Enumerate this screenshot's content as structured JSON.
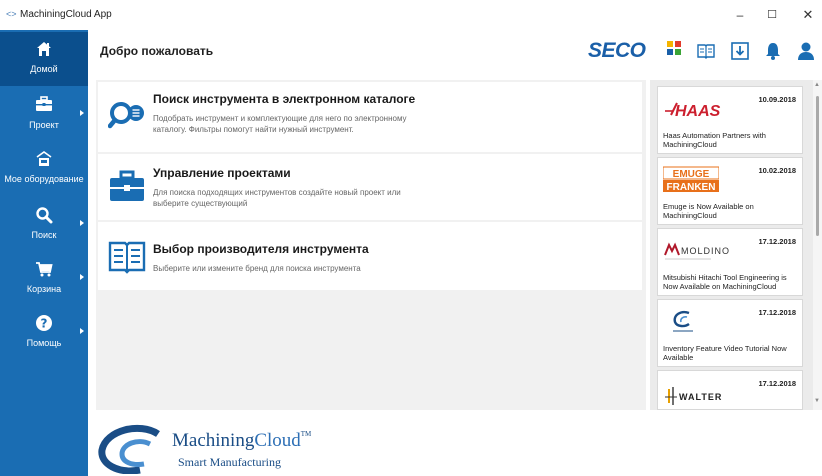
{
  "window": {
    "title": "MachiningCloud App",
    "controls": {
      "minimize": "–",
      "maximize": "☐",
      "close": "✕"
    }
  },
  "sidebar": {
    "items": [
      {
        "label": "Домой",
        "icon": "home-icon",
        "active": true,
        "has_submenu": false
      },
      {
        "label": "Проект",
        "icon": "briefcase-icon",
        "active": false,
        "has_submenu": true
      },
      {
        "label": "Мое оборудование",
        "icon": "machine-icon",
        "active": false,
        "has_submenu": false
      },
      {
        "label": "Поиск",
        "icon": "search-icon",
        "active": false,
        "has_submenu": true
      },
      {
        "label": "Корзина",
        "icon": "cart-icon",
        "active": false,
        "has_submenu": true
      },
      {
        "label": "Помощь",
        "icon": "help-icon",
        "active": false,
        "has_submenu": true
      }
    ]
  },
  "header": {
    "title": "Добро пожаловать",
    "brand": "SECO",
    "icons": [
      "catalog-book-icon",
      "download-icon",
      "bell-icon",
      "user-icon"
    ]
  },
  "cards": [
    {
      "title": "Поиск инструмента в электронном каталоге",
      "description": "Подобрать инструмент и комплектующие для него по электронному каталогу. Фильтры помогут найти нужный инструмент.",
      "icon": "catalog-search-icon"
    },
    {
      "title": "Управление проектами",
      "description": "Для поиска подходящих инструментов создайте новый проект или выберите существующий",
      "icon": "briefcase-icon"
    },
    {
      "title": "Выбор производителя инструмента",
      "description": "Выберите или измените бренд для поиска инструмента",
      "icon": "open-book-icon"
    }
  ],
  "news": [
    {
      "date": "10.09.2018",
      "logo": "HAAS",
      "text": "Haas Automation Partners with MachiningCloud"
    },
    {
      "date": "10.02.2018",
      "logo": "EMUGE FRANKEN",
      "text": "Emuge is Now Available on MachiningCloud"
    },
    {
      "date": "17.12.2018",
      "logo": "MOLDINO",
      "text": "Mitsubishi Hitachi Tool Engineering is Now Available on MachiningCloud"
    },
    {
      "date": "17.12.2018",
      "logo": "MachiningCloud",
      "text": "Inventory Feature Video Tutorial Now Available"
    },
    {
      "date": "17.12.2018",
      "logo": "WALTER",
      "text": ""
    }
  ],
  "footer": {
    "brand_dark": "Machining",
    "brand_light": "Cloud",
    "trademark": "TM",
    "tagline": "Smart Manufacturing"
  },
  "colors": {
    "sidebar": "#1a6db3",
    "sidebar_active": "#0b4f8d",
    "accent": "#1a5fa8",
    "haas_red": "#cc1f2e",
    "emuge_orange": "#e8701a"
  }
}
